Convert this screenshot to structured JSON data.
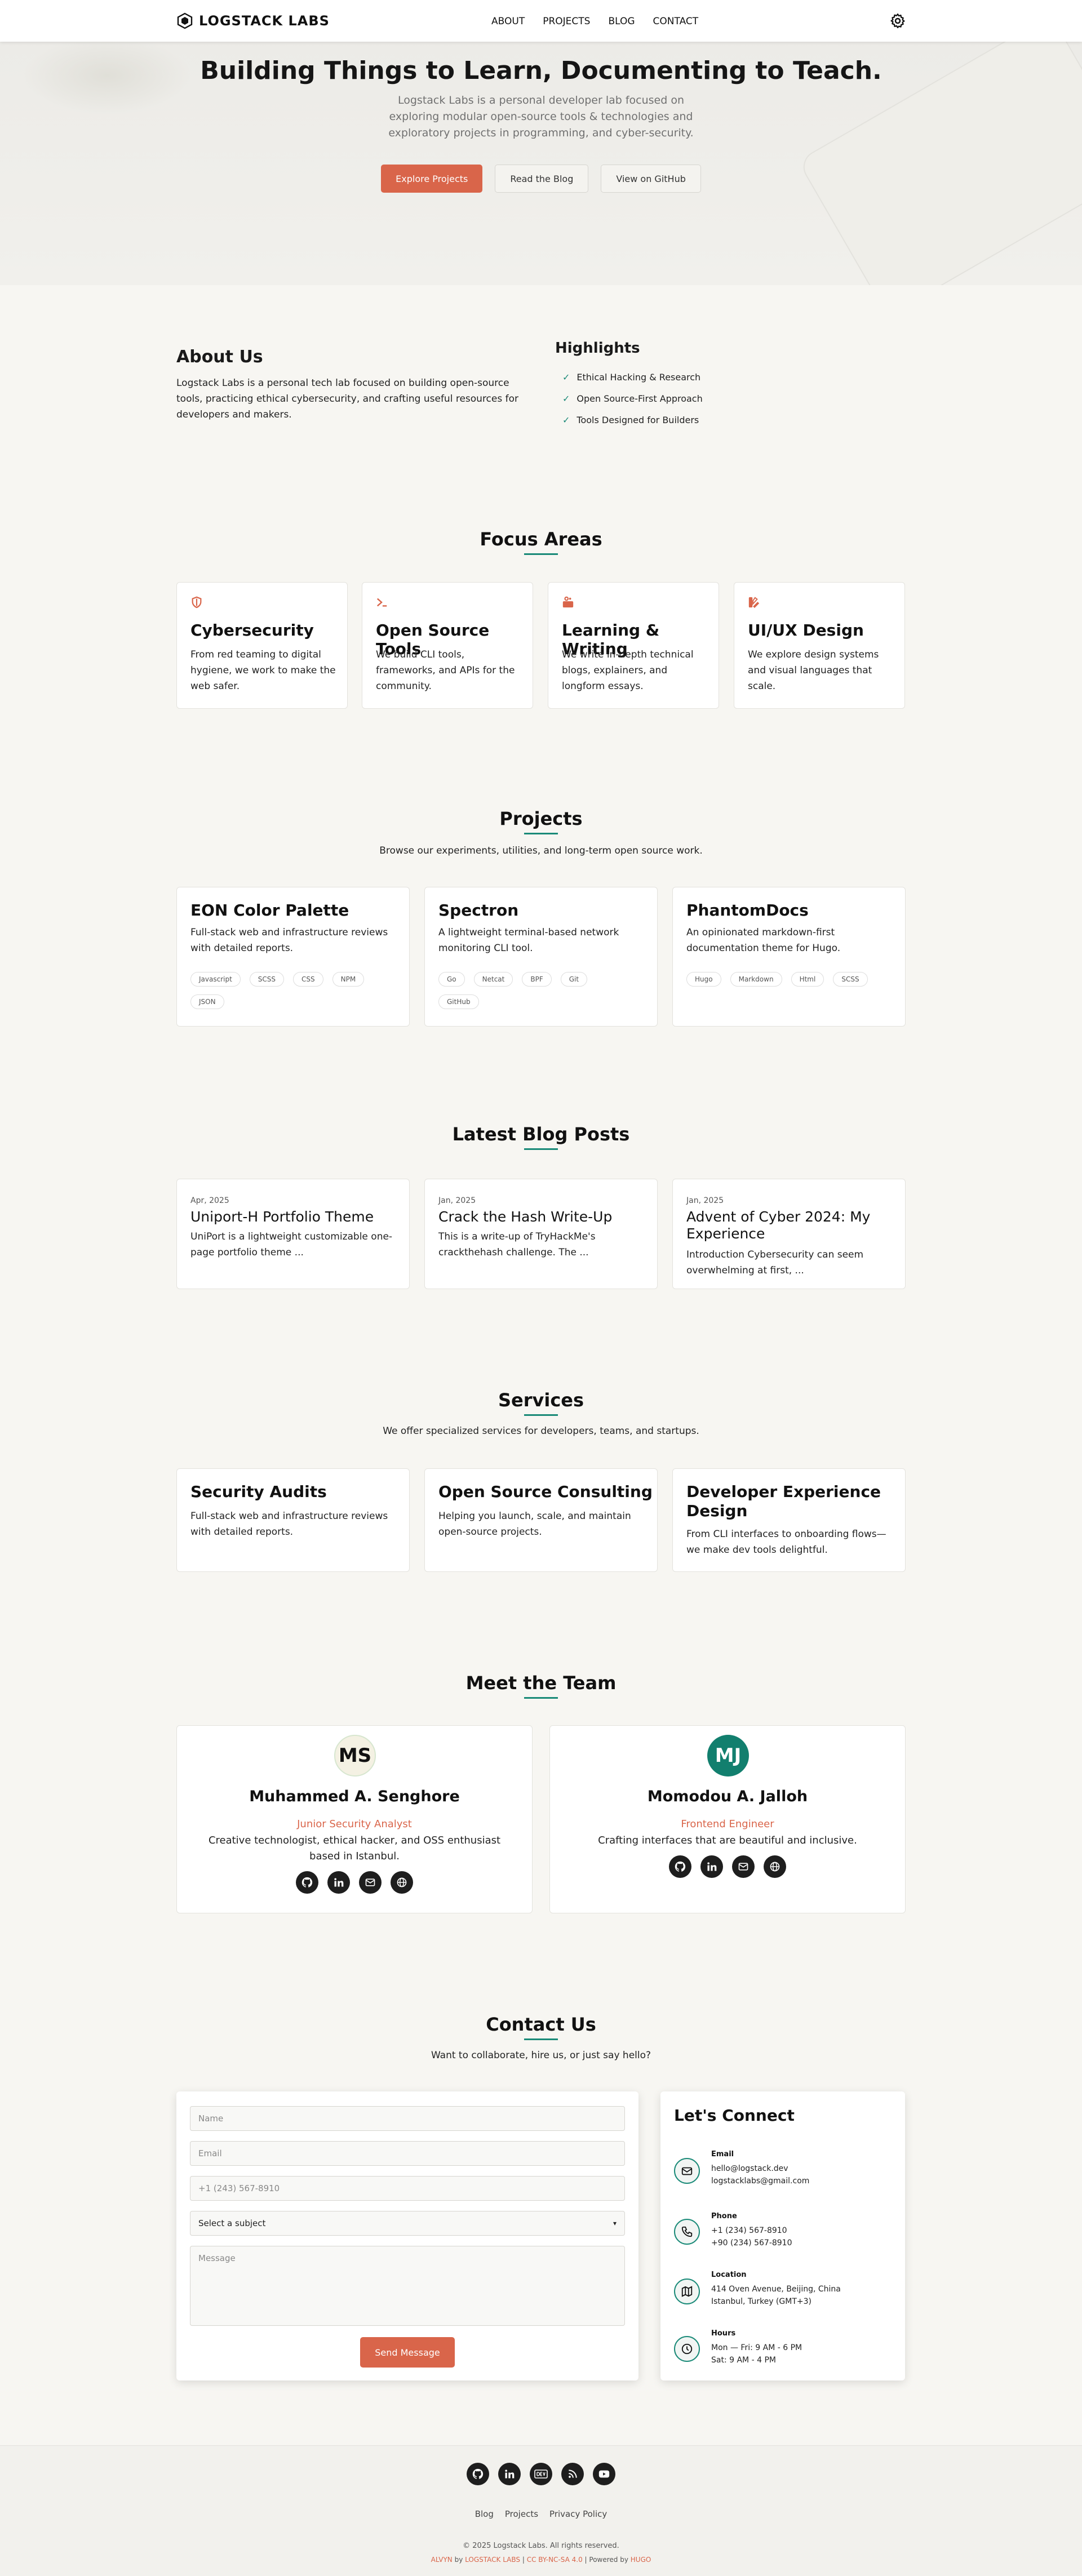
{
  "nav": {
    "logo": "LOGSTACK LABS",
    "links": [
      "ABOUT",
      "PROJECTS",
      "BLOG",
      "CONTACT"
    ]
  },
  "hero": {
    "title": "Building Things to Learn, Documenting to Teach.",
    "subtitle": "Logstack Labs is a personal developer lab focused on exploring modular open-source tools & technologies and exploratory projects in programming, and cyber-security.",
    "buttons": [
      "Explore Projects",
      "Read the Blog",
      "View on GitHub"
    ]
  },
  "about": {
    "title": "About Us",
    "text": "Logstack Labs is a personal tech lab focused on building open-source tools, practicing ethical cybersecurity, and crafting useful resources for developers and makers.",
    "highlights_title": "Highlights",
    "highlights": [
      "Ethical Hacking & Research",
      "Open Source-First Approach",
      "Tools Designed for Builders"
    ]
  },
  "focus": {
    "title": "Focus Areas",
    "cards": [
      {
        "icon": "shield-icon",
        "title": "Cybersecurity",
        "text": "From red teaming to digital hygiene, we work to make the web safer."
      },
      {
        "icon": "terminal-icon",
        "title": "Open Source Tools",
        "text": "We build CLI tools, frameworks, and APIs for the community."
      },
      {
        "icon": "writing-icon",
        "title": "Learning & Writing",
        "text": "We write in-depth technical blogs, explainers, and longform essays."
      },
      {
        "icon": "design-icon",
        "title": "UI/UX Design",
        "text": "We explore design systems and visual languages that scale."
      }
    ]
  },
  "projects": {
    "title": "Projects",
    "subtitle": "Browse our experiments, utilities, and long-term open source work.",
    "cards": [
      {
        "title": "EON Color Palette",
        "text": "Full-stack web and infrastructure reviews with detailed reports.",
        "tags": [
          "Javascript",
          "SCSS",
          "CSS",
          "NPM",
          "JSON"
        ]
      },
      {
        "title": "Spectron",
        "text": "A lightweight terminal-based network monitoring CLI tool.",
        "tags": [
          "Go",
          "Netcat",
          "BPF",
          "Git",
          "GitHub"
        ]
      },
      {
        "title": "PhantomDocs",
        "text": "An opinionated markdown-first documentation theme for Hugo.",
        "tags": [
          "Hugo",
          "Markdown",
          "Html",
          "SCSS"
        ]
      }
    ]
  },
  "blog": {
    "title": "Latest Blog Posts",
    "posts": [
      {
        "date": "Apr, 2025",
        "title": "Uniport-H Portfolio Theme",
        "text": "UniPort is a lightweight customizable one-page portfolio theme ..."
      },
      {
        "date": "Jan, 2025",
        "title": "Crack the Hash Write-Up",
        "text": "This is a write-up of TryHackMe's crackthehash challenge. The ..."
      },
      {
        "date": "Jan, 2025",
        "title": "Advent of Cyber 2024: My Experience",
        "text": "Introduction Cybersecurity can seem overwhelming at first, ..."
      }
    ]
  },
  "services": {
    "title": "Services",
    "subtitle": "We offer specialized services for developers, teams, and startups.",
    "cards": [
      {
        "title": "Security Audits",
        "text": "Full-stack web and infrastructure reviews with detailed reports."
      },
      {
        "title": "Open Source Consulting",
        "text": "Helping you launch, scale, and maintain open-source projects."
      },
      {
        "title": "Developer Experience Design",
        "text": "From CLI interfaces to onboarding flows—we make dev tools delightful."
      }
    ]
  },
  "team": {
    "title": "Meet the Team",
    "members": [
      {
        "initials": "MS",
        "name": "Muhammed A. Senghore",
        "role": "Junior Security Analyst",
        "bio": "Creative technologist, ethical hacker, and OSS enthusiast based in Istanbul."
      },
      {
        "initials": "MJ",
        "name": "Momodou A. Jalloh",
        "role": "Frontend Engineer",
        "bio": "Crafting interfaces that are beautiful and inclusive."
      }
    ]
  },
  "contact": {
    "title": "Contact Us",
    "subtitle": "Want to collaborate, hire us, or just say hello?",
    "placeholders": {
      "name": "Name",
      "email": "Email",
      "phone": "+1 (243) 567-8910",
      "subject": "Select a subject",
      "message": "Message"
    },
    "send": "Send Message",
    "connect_title": "Let's Connect",
    "info": [
      {
        "icon": "envelope-icon",
        "label": "Email",
        "lines": [
          "hello@logstack.dev",
          "logstacklabs@gmail.com"
        ]
      },
      {
        "icon": "phone-icon",
        "label": "Phone",
        "lines": [
          "+1 (234) 567-8910",
          "+90 (234) 567-8910"
        ]
      },
      {
        "icon": "map-icon",
        "label": "Location",
        "lines": [
          "414 Oven Avenue, Beijing, China",
          "Istanbul, Turkey (GMT+3)"
        ]
      },
      {
        "icon": "clock-icon",
        "label": "Hours",
        "lines": [
          "Mon — Fri: 9 AM - 6 PM",
          "Sat: 9 AM - 4 PM"
        ]
      }
    ]
  },
  "footer": {
    "links": [
      "Blog",
      "Projects",
      "Privacy Policy"
    ],
    "copyright": "© 2025 Logstack Labs. All rights reserved.",
    "credit_a": "ALVYN",
    "credit_b": " by ",
    "credit_c": "LOGSTACK LABS",
    "credit_d": " | ",
    "credit_e": "CC BY-NC-SA 4.0",
    "credit_f": " | Powered by ",
    "credit_g": "HUGO"
  },
  "colors": {
    "accent": "#d9654a",
    "teal": "#1a8a78",
    "background": "#f7f6f2"
  }
}
